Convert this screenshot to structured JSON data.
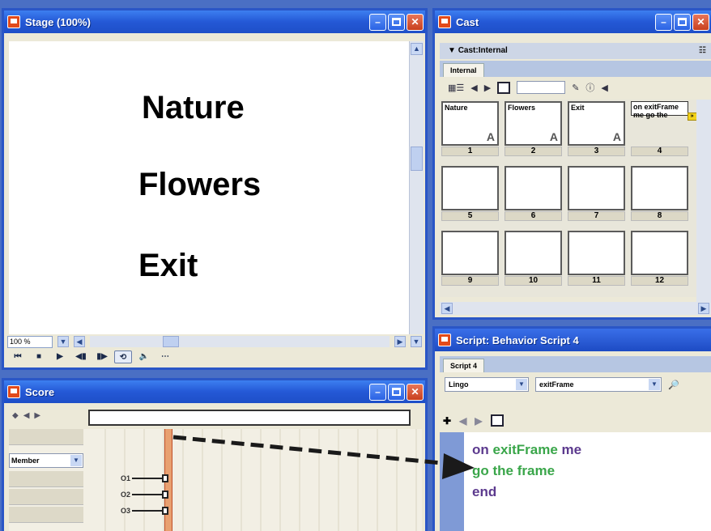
{
  "stage": {
    "title": "Stage (100%)",
    "words": [
      "Nature",
      "Flowers",
      "Exit"
    ],
    "zoom": "100 %"
  },
  "cast": {
    "title": "Cast",
    "header": "Cast:Internal",
    "tab": "Internal",
    "members": [
      {
        "number": "1",
        "name": "Nature",
        "type": "A"
      },
      {
        "number": "2",
        "name": "Flowers",
        "type": "A"
      },
      {
        "number": "3",
        "name": "Exit",
        "type": "A"
      },
      {
        "number": "4",
        "name": "on exitFrame me  go the",
        "type": "script"
      },
      {
        "number": "5"
      },
      {
        "number": "6"
      },
      {
        "number": "7"
      },
      {
        "number": "8"
      },
      {
        "number": "9"
      },
      {
        "number": "10"
      },
      {
        "number": "11"
      },
      {
        "number": "12"
      }
    ]
  },
  "score": {
    "title": "Score",
    "member_dropdown": "Member",
    "channels": [
      "O1",
      "O2",
      "O3"
    ]
  },
  "script": {
    "title": "Script: Behavior Script 4",
    "tab": "Script 4",
    "language": "Lingo",
    "handler": "exitFrame",
    "lines": [
      {
        "parts": [
          {
            "t": "on ",
            "c": "kw"
          },
          {
            "t": "exitFrame ",
            "c": "fn"
          },
          {
            "t": "me",
            "c": "kw"
          }
        ]
      },
      {
        "parts": [
          {
            "t": "  go the ",
            "c": "fn"
          },
          {
            "t": "frame",
            "c": "fn"
          }
        ]
      },
      {
        "parts": [
          {
            "t": "end",
            "c": "kw"
          }
        ]
      }
    ]
  },
  "colors": {
    "titlebar": "#2458d6",
    "close_button": "#c8401e",
    "arrow": "#1a1a1a",
    "lingo_keyword": "#5c3a8e",
    "lingo_builtin": "#3aa64a"
  }
}
